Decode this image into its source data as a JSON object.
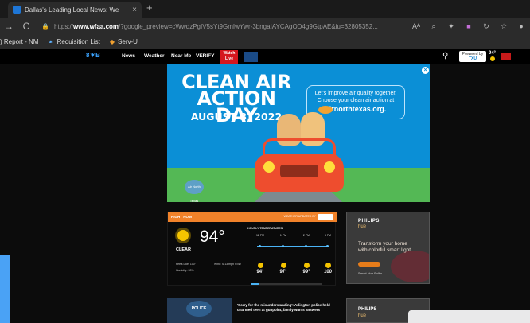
{
  "browser": {
    "tab_title": "Dallas's Leading Local News: We",
    "tab_close": "×",
    "new_tab": "+",
    "back": "→",
    "reload": "C",
    "url_prefix": "https://",
    "url_domain": "www.wfaa.com",
    "url_rest": "/?google_preview=cWwdzPgIV5sYt9GmIwYwr-3bngaIAYCAgOD4g9GtpAE&iu=32805352...",
    "read_aloud": "Aᴬ",
    "zoom": "⌕"
  },
  "bookmarks": [
    {
      "label": ") Report - NM"
    },
    {
      "label": "Requisition List"
    },
    {
      "label": "Serv-U"
    }
  ],
  "site": {
    "logo": "8✶B",
    "nav": [
      "News",
      "Weather",
      "Near Me",
      "VERIFY"
    ],
    "watch_live": [
      "Watch",
      "Live"
    ],
    "search_icon": "🔍",
    "sponsor_line1": "Powered by",
    "sponsor_line2": "TXU",
    "header_temp": "94°"
  },
  "ad": {
    "title_lines": [
      "CLEAN AIR",
      "ACTION DAY"
    ],
    "date": "AUGUST 3, 2022",
    "message": "Let's improve air quality together. Choose your clean air action at",
    "site": "airnorthtexas.org.",
    "close": "×",
    "badge": "Air North Texas"
  },
  "weather": {
    "header_left": "RIGHT NOW",
    "header_right": "WEATHER UPDATED BY",
    "temp": "94°",
    "condition": "CLEAR",
    "feels_like": "Feels Like: 100°",
    "wind": "Wind: S 13 mph SSW",
    "humidity": "Humidity: 33%",
    "hourly_label": "HOURLY TEMPERATURES",
    "hours": [
      {
        "time": "12 PM",
        "temp": "94°"
      },
      {
        "time": "1 PM",
        "temp": "97°"
      },
      {
        "time": "2 PM",
        "temp": "99°"
      },
      {
        "time": "3 PM",
        "temp": "100"
      }
    ],
    "progress": 0.12
  },
  "philips_ad": {
    "logo": "PHILIPS",
    "hue": "hue",
    "text": "Transform your home with colorful smart light",
    "caption": "Smart Hue Bulbs"
  },
  "news": {
    "badge": "POLICE",
    "headline": "'Sorry for the misunderstanding': Arlington police held unarmed teen at gunpoint, family wants answers"
  },
  "philips_ad2": {
    "logo": "PHILIPS",
    "hue": "hue"
  }
}
